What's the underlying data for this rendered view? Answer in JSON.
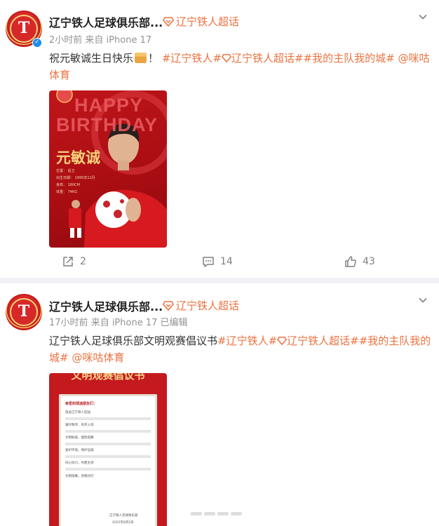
{
  "posts": [
    {
      "author": "辽宁铁人足球俱乐部...",
      "supertopic": "辽宁铁人超话",
      "time": "2小时前",
      "source": "来自 iPhone 17",
      "edited": "",
      "text_prefix": "祝元敏诚生日快乐",
      "text_suffix": "！",
      "tags": [
        "#辽宁铁人#",
        "辽宁铁人超话#",
        "#我的主队我的城#",
        "@咪咕",
        "体育"
      ],
      "poster": {
        "headline1": "HAPPY",
        "headline2": "BIRTHDAY",
        "player_name": "元敏诚",
        "info": [
          "位置： 后卫",
          "出生日期： 1995年11月",
          "身高： 180CM",
          "体重： 74KG"
        ]
      },
      "actions": {
        "repost": "2",
        "comment": "14",
        "like": "43"
      }
    },
    {
      "author": "辽宁铁人足球俱乐部...",
      "supertopic": "辽宁铁人超话",
      "time": "17小时前",
      "source": "来自 iPhone 17",
      "edited": "已编辑",
      "text_prefix": "辽宁铁人足球俱乐部文明观赛倡议书",
      "tags": [
        "#辽宁铁人#",
        "辽宁铁人超话#",
        "#我的主队我的",
        "城#",
        "@咪咕体育"
      ],
      "poster": {
        "title": "文明观赛倡议书",
        "greeting": "亲爱的球迷朋友们：",
        "paragraphs": [
          "值此辽宁铁人迎战",
          "遵守秩序，有序入场",
          "文明助威，理性观赛",
          "爱护环境，保护设施",
          "同心协力，共建主场"
        ],
        "closing": "文明观赛，你我同行",
        "signature": "辽宁铁人足球俱乐部",
        "date": "2025年8月2日"
      }
    }
  ],
  "colors": {
    "accent": "#eb7340",
    "text": "#333333",
    "meta": "#939393",
    "club_red": "#c41a1f"
  }
}
